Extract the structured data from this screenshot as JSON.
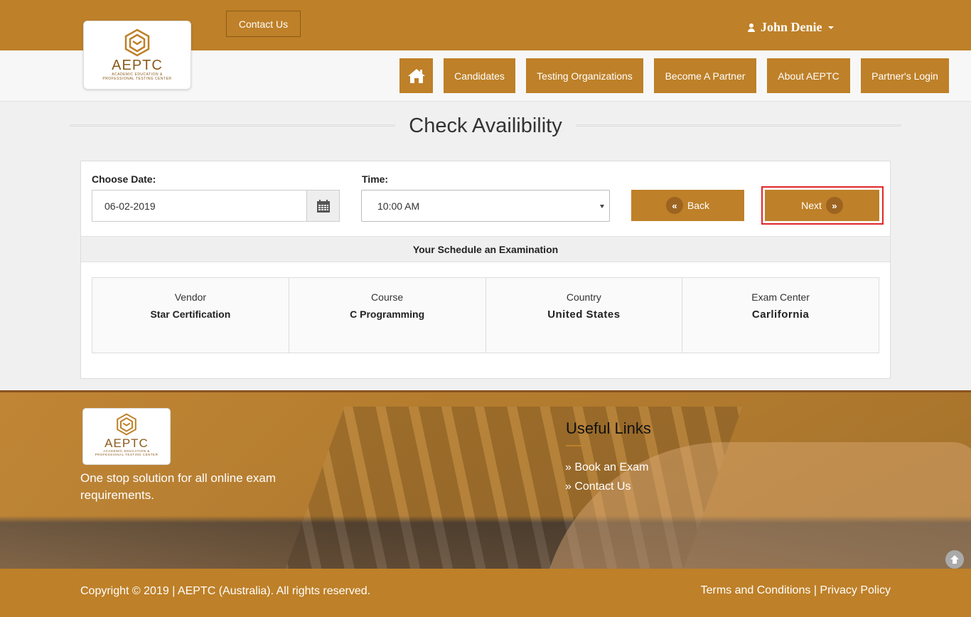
{
  "colors": {
    "brand": "#be8028",
    "brand_dark": "#8a5a1a",
    "highlight": "#e0262a"
  },
  "topbar": {
    "contact_label": "Contact Us",
    "user_name": "John Denie"
  },
  "logo": {
    "name": "AEPTC",
    "sub_line1": "Academic Education &",
    "sub_line2": "Professional Testing Center"
  },
  "nav": {
    "home_icon": "home-icon",
    "items": [
      {
        "label": "Candidates"
      },
      {
        "label": "Testing Organizations"
      },
      {
        "label": "Become A Partner"
      },
      {
        "label": "About AEPTC"
      },
      {
        "label": "Partner's Login"
      }
    ]
  },
  "page": {
    "title": "Check Availibility"
  },
  "form": {
    "date_label": "Choose Date:",
    "date_value": "06-02-2019",
    "time_label": "Time:",
    "time_value": "10:00 AM",
    "back_label": "Back",
    "next_label": "Next"
  },
  "schedule": {
    "heading": "Your Schedule an Examination",
    "columns": [
      {
        "key": "Vendor",
        "value": "Star Certification"
      },
      {
        "key": "Course",
        "value": "C Programming"
      },
      {
        "key": "Country",
        "value": "United States"
      },
      {
        "key": "Exam Center",
        "value": "Carlifornia"
      }
    ]
  },
  "footer": {
    "tagline": "One stop solution for all online exam requirements.",
    "useful_title": "Useful Links",
    "links": [
      {
        "label": "Book an Exam"
      },
      {
        "label": "Contact Us"
      }
    ],
    "copyright": "Copyright © 2019 | AEPTC (Australia). All rights reserved.",
    "terms": "Terms and Conditions",
    "separator": "|",
    "privacy": "Privacy Policy"
  }
}
